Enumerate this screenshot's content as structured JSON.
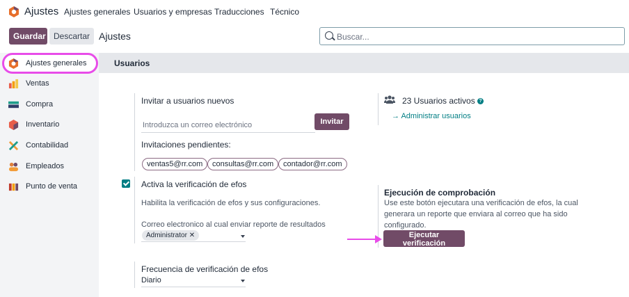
{
  "topnav": {
    "app_title": "Ajustes",
    "menu": [
      "Ajustes generales",
      "Usuarios y empresas",
      "Traducciones",
      "Técnico"
    ]
  },
  "control_panel": {
    "save_label": "Guardar",
    "discard_label": "Descartar",
    "breadcrumb": "Ajustes",
    "search_placeholder": "Buscar..."
  },
  "sidebar": {
    "items": [
      {
        "label": "Ajustes generales",
        "icon": "settings-icon",
        "color": "#e76f2b"
      },
      {
        "label": "Ventas",
        "icon": "sales-icon",
        "color": "#f59e0b"
      },
      {
        "label": "Compra",
        "icon": "purchase-icon",
        "color": "#1f9d8b"
      },
      {
        "label": "Inventario",
        "icon": "inventory-icon",
        "color": "#e85d4a"
      },
      {
        "label": "Contabilidad",
        "icon": "accounting-icon",
        "color": "#f29c38"
      },
      {
        "label": "Empleados",
        "icon": "employees-icon",
        "color": "#e0803b"
      },
      {
        "label": "Punto de venta",
        "icon": "pos-icon",
        "color": "#c0392b"
      }
    ]
  },
  "section": {
    "title": "Usuarios"
  },
  "invite": {
    "title": "Invitar a usuarios nuevos",
    "email_placeholder": "Introduzca un correo electrónico",
    "invite_label": "Invitar",
    "pending_title": "Invitaciones pendientes:",
    "pending": [
      "ventas5@rr.com",
      "consultas@rr.com",
      "contador@rr.com"
    ]
  },
  "users": {
    "count_label": "23 Usuarios activos",
    "help": "?",
    "manage_label": "Administrar usuarios"
  },
  "efos": {
    "checked": true,
    "title": "Activa la verificación de efos",
    "description": "Habilita la verificación de efos y sus configuraciones.",
    "email_label": "Correo electronico al cual enviar reporte de resultados",
    "tag": "Administrator",
    "tag_remove": "✕"
  },
  "check_run": {
    "title": "Ejecución de comprobación",
    "description_lines": [
      "Use este botón ejecutara una verificación de efos, la cual",
      "generara un reporte que enviara al correo que ha sido",
      "configurado."
    ],
    "button_label": "Ejecutar verificación"
  },
  "frequency": {
    "title": "Frecuencia de verificación de efos",
    "value": "Diario"
  },
  "colors": {
    "brand": "#714b67",
    "accent": "#017e84",
    "highlight": "#e84ce9"
  }
}
